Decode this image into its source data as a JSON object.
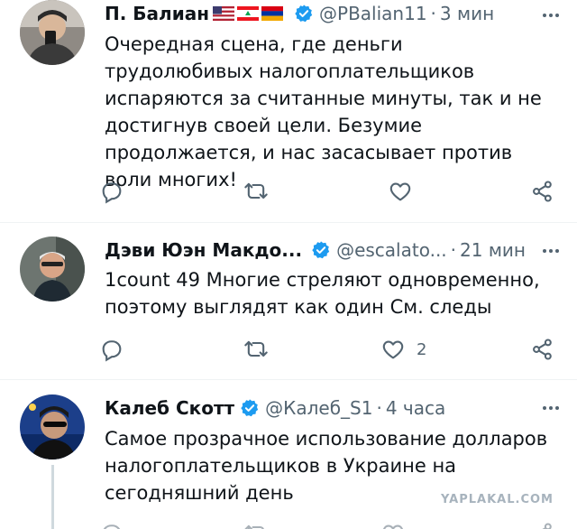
{
  "tweets": [
    {
      "name": "П. Балиан",
      "handle": "@PBalian11",
      "time": "3 мин",
      "text": "Очередная сцена, где деньги трудолюбивых налогоплательщиков испаряются за считанные минуты, так и не достигнув своей цели. Безумие продолжается, и нас засасывает против воли многих!",
      "like_count": "",
      "flags": [
        "us-flag",
        "lebanon-flag",
        "armenia-flag"
      ]
    },
    {
      "name": "Дэви Юэн Макдо...",
      "handle": "@escalato...",
      "time": "21 мин",
      "text": "1count 49 Многие стреляют одновременно, поэтому выглядят как один См. следы",
      "like_count": "2"
    },
    {
      "name": "Калеб Скотт",
      "handle": "@Калеб_S1",
      "time": "4 часа",
      "text": "Самое прозрачное использование долларов налогоплательщиков в Украине на сегодняшний день",
      "like_count": ""
    }
  ],
  "separator": "·",
  "watermark": "YAPLAKAL.COM",
  "colors": {
    "verified": "#1d9bf0",
    "muted": "#536471",
    "divider": "#eff3f4"
  }
}
